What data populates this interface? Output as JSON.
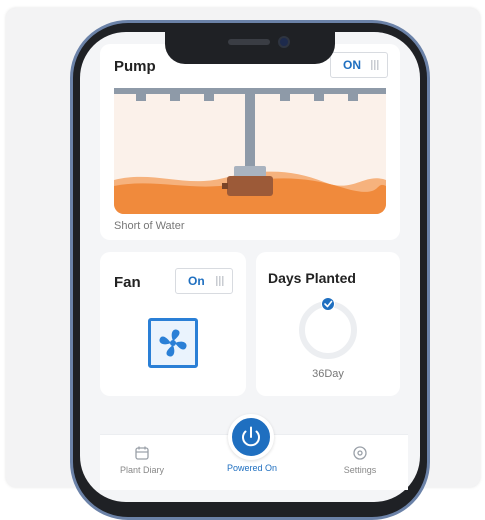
{
  "pump": {
    "title": "Pump",
    "toggle_label": "ON",
    "status_text": "Short of Water"
  },
  "fan": {
    "title": "Fan",
    "toggle_label": "On"
  },
  "days_planted": {
    "title": "Days Planted",
    "value": "36Day"
  },
  "nav": {
    "plant_diary": "Plant Diary",
    "powered_on": "Powered On",
    "settings": "Settings"
  },
  "colors": {
    "accent": "#1f6fc0",
    "soil": "#f08a3c",
    "soil_light": "#f6b27d",
    "pipe": "#8e9aa8"
  },
  "icons": {
    "fan": "fan-icon",
    "check": "check-icon",
    "diary": "calendar-icon",
    "power": "power-icon",
    "settings": "gear-icon"
  }
}
